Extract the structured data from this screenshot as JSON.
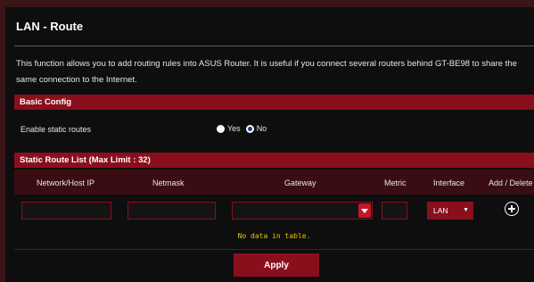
{
  "page": {
    "title": "LAN - Route",
    "description": "This function allows you to add routing rules into ASUS Router. It is useful if you connect several routers behind GT-BE98 to share the same connection to the Internet."
  },
  "basic_config": {
    "section_title": "Basic Config",
    "static_routes_label": "Enable static routes",
    "option_yes": "Yes",
    "option_no": "No",
    "selected": "No"
  },
  "route_list": {
    "section_title": "Static Route List (Max Limit : 32)",
    "columns": [
      "Network/Host IP",
      "Netmask",
      "Gateway",
      "Metric",
      "Interface",
      "Add / Delete"
    ],
    "new_entry": {
      "network_ip": "",
      "netmask": "",
      "gateway": "",
      "metric": "",
      "interface": "LAN"
    },
    "empty_message": "No data in table."
  },
  "actions": {
    "apply_label": "Apply"
  },
  "icons": {
    "add": "plus-circle-icon",
    "dropdown": "chevron-down-icon"
  },
  "colors": {
    "accent": "#8a0f1d",
    "highlight": "#c0182b",
    "notice": "#e8c400"
  }
}
